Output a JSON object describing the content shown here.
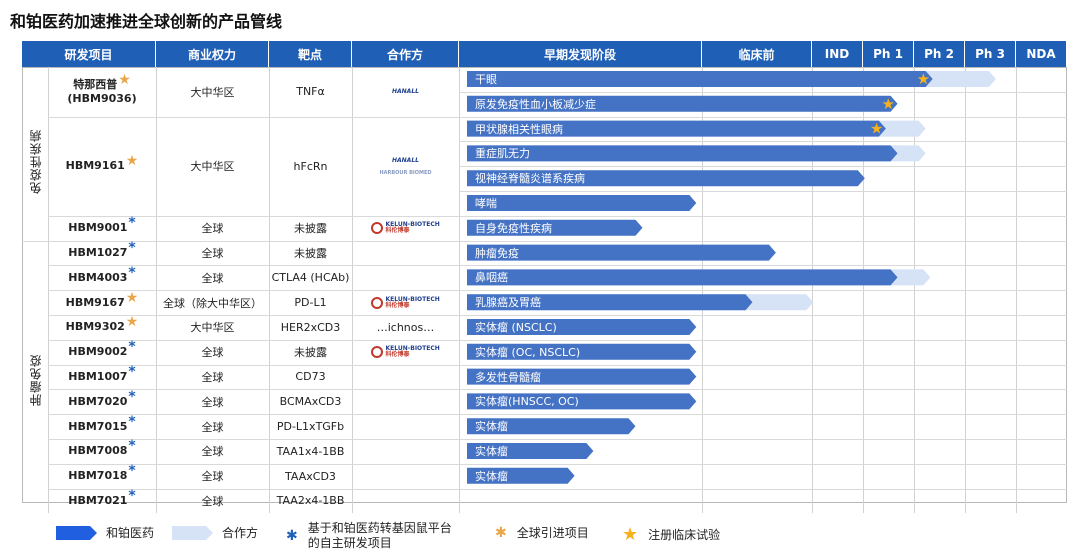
{
  "title": "和铂医药加速推进全球创新的产品管线",
  "colors": {
    "header_bg": "#1f5fb6",
    "own_bar": "#4472c4",
    "partner_bar": "#d6e2f6",
    "star": "#f5b21a",
    "blue_mark": "#1f5fb6",
    "orange_mark": "#e9a64a"
  },
  "headers": {
    "project": "研发项目",
    "rights": "商业权力",
    "target": "靶点",
    "partner": "合作方",
    "discovery": "早期发现阶段",
    "preclinical": "临床前",
    "ind": "IND",
    "ph1": "Ph 1",
    "ph2": "Ph 2",
    "ph3": "Ph 3",
    "nda": "NDA"
  },
  "categories": [
    {
      "label": "免疫性疾病"
    },
    {
      "label": "肿瘤免疫"
    }
  ],
  "projects": [
    {
      "name": "特那西普",
      "name2": "(HBM9036)",
      "mark": "★",
      "mark_color": "orange",
      "rights": "大中华区",
      "target": "TNFα",
      "partner": "HANALL"
    },
    {
      "name": "HBM9161",
      "name2": "",
      "mark": "★",
      "mark_color": "orange",
      "rights": "大中华区",
      "target": "hFcRn",
      "partner": "HANALL"
    },
    {
      "name": "HBM9001",
      "name2": "",
      "mark": "*",
      "mark_color": "blue",
      "rights": "全球",
      "target": "未披露",
      "partner": "KELUN-BIOTECH"
    },
    {
      "name": "HBM1027",
      "name2": "",
      "mark": "*",
      "mark_color": "blue",
      "rights": "全球",
      "target": "未披露",
      "partner": ""
    },
    {
      "name": "HBM4003",
      "name2": "",
      "mark": "*",
      "mark_color": "blue",
      "rights": "全球",
      "target": "CTLA4 (HCAb)",
      "partner": ""
    },
    {
      "name": "HBM9167",
      "name2": "",
      "mark": "★",
      "mark_color": "orange",
      "rights": "全球（除大中华区）",
      "target": "PD-L1",
      "partner": "KELUN-BIOTECH"
    },
    {
      "name": "HBM9302",
      "name2": "",
      "mark": "★",
      "mark_color": "orange",
      "rights": "大中华区",
      "target": "HER2xCD3",
      "partner": "…ichnos…"
    },
    {
      "name": "HBM9002",
      "name2": "",
      "mark": "*",
      "mark_color": "blue",
      "rights": "全球",
      "target": "未披露",
      "partner": "KELUN-BIOTECH"
    },
    {
      "name": "HBM1007",
      "name2": "",
      "mark": "*",
      "mark_color": "blue",
      "rights": "全球",
      "target": "CD73",
      "partner": ""
    },
    {
      "name": "HBM7020",
      "name2": "",
      "mark": "*",
      "mark_color": "blue",
      "rights": "全球",
      "target": "BCMAxCD3",
      "partner": ""
    },
    {
      "name": "HBM7015",
      "name2": "",
      "mark": "*",
      "mark_color": "blue",
      "rights": "全球",
      "target": "PD-L1xTGFb",
      "partner": ""
    },
    {
      "name": "HBM7008",
      "name2": "",
      "mark": "*",
      "mark_color": "blue",
      "rights": "全球",
      "target": "TAA1x4-1BB",
      "partner": ""
    },
    {
      "name": "HBM7018",
      "name2": "",
      "mark": "*",
      "mark_color": "blue",
      "rights": "全球",
      "target": "TAAxCD3",
      "partner": ""
    },
    {
      "name": "HBM7021",
      "name2": "",
      "mark": "*",
      "mark_color": "blue",
      "rights": "全球",
      "target": "TAA2x4-1BB",
      "partner": ""
    }
  ],
  "partner_text": {
    "hanall": "HANALL",
    "kelun1": "KELUN-BIOTECH",
    "kelun2": "科伦博泰",
    "hbm_small": "HARBOUR BIOMED"
  },
  "chart_data": {
    "type": "bar",
    "stages": [
      "早期发现阶段",
      "临床前",
      "IND",
      "Ph 1",
      "Ph 2",
      "Ph 3",
      "NDA"
    ],
    "series": [
      {
        "name": "和铂医药"
      },
      {
        "name": "合作方"
      }
    ],
    "indications": [
      {
        "label": "干眼",
        "own_end": "Ph 2",
        "partner_end": "Ph 3",
        "star": true
      },
      {
        "label": "原发免疫性血小板减少症",
        "own_end": "Ph 2",
        "partner_end": null,
        "star": true
      },
      {
        "label": "甲状腺相关性眼病",
        "own_end": "Ph 2",
        "partner_end": "Ph 2",
        "star": true
      },
      {
        "label": "重症肌无力",
        "own_end": "Ph 2",
        "partner_end": "Ph 2",
        "star": false
      },
      {
        "label": "视神经脊髓炎谱系疾病",
        "own_end": "Ph 2",
        "partner_end": null,
        "star": false
      },
      {
        "label": "哮喘",
        "own_end": "临床前",
        "partner_end": null,
        "star": false
      },
      {
        "label": "自身免疫性疾病",
        "own_end": "早期发现阶段",
        "partner_end": null,
        "star": false
      },
      {
        "label": "肿瘤免疫",
        "own_end": "Ph 1",
        "partner_end": null,
        "star": false
      },
      {
        "label": "鼻咽癌",
        "own_end": "Ph 2",
        "partner_end": "Ph 2",
        "star": false
      },
      {
        "label": "乳腺癌及胃癌",
        "own_end": "Ph 1",
        "partner_end": "Ph 1",
        "star": false
      },
      {
        "label": "实体瘤 (NSCLC)",
        "own_end": "临床前",
        "partner_end": null,
        "star": false
      },
      {
        "label": "实体瘤 (OC, NSCLC)",
        "own_end": "临床前",
        "partner_end": null,
        "star": false
      },
      {
        "label": "多发性骨髓瘤",
        "own_end": "临床前",
        "partner_end": null,
        "star": false
      },
      {
        "label": "实体瘤(HNSCC, OC)",
        "own_end": "临床前",
        "partner_end": null,
        "star": false
      },
      {
        "label": "实体瘤",
        "own_end": "早期发现阶段",
        "partner_end": null,
        "star": false
      },
      {
        "label": "实体瘤",
        "own_end": "早期发现阶段",
        "partner_end": null,
        "star": false
      },
      {
        "label": "实体瘤",
        "own_end": "早期发现阶段",
        "partner_end": null,
        "star": false
      }
    ],
    "own_progress": [
      0.995,
      0.92,
      0.895,
      0.92,
      0.85,
      0.49,
      0.375,
      0.66,
      0.92,
      0.61,
      0.49,
      0.49,
      0.49,
      0.49,
      0.36,
      0.27,
      0.23
    ],
    "partner_progress": [
      1.13,
      null,
      0.98,
      0.98,
      null,
      null,
      null,
      null,
      0.99,
      0.74,
      null,
      null,
      null,
      null,
      null,
      null,
      null
    ]
  },
  "legend": {
    "own": "和铂医药",
    "partner": "合作方",
    "blue_mark_text_1": "基于和铂医药转基因鼠平台",
    "blue_mark_text_2": "的自主研发项目",
    "orange_mark_text": "全球引进项目",
    "star_text": "注册临床试验"
  }
}
